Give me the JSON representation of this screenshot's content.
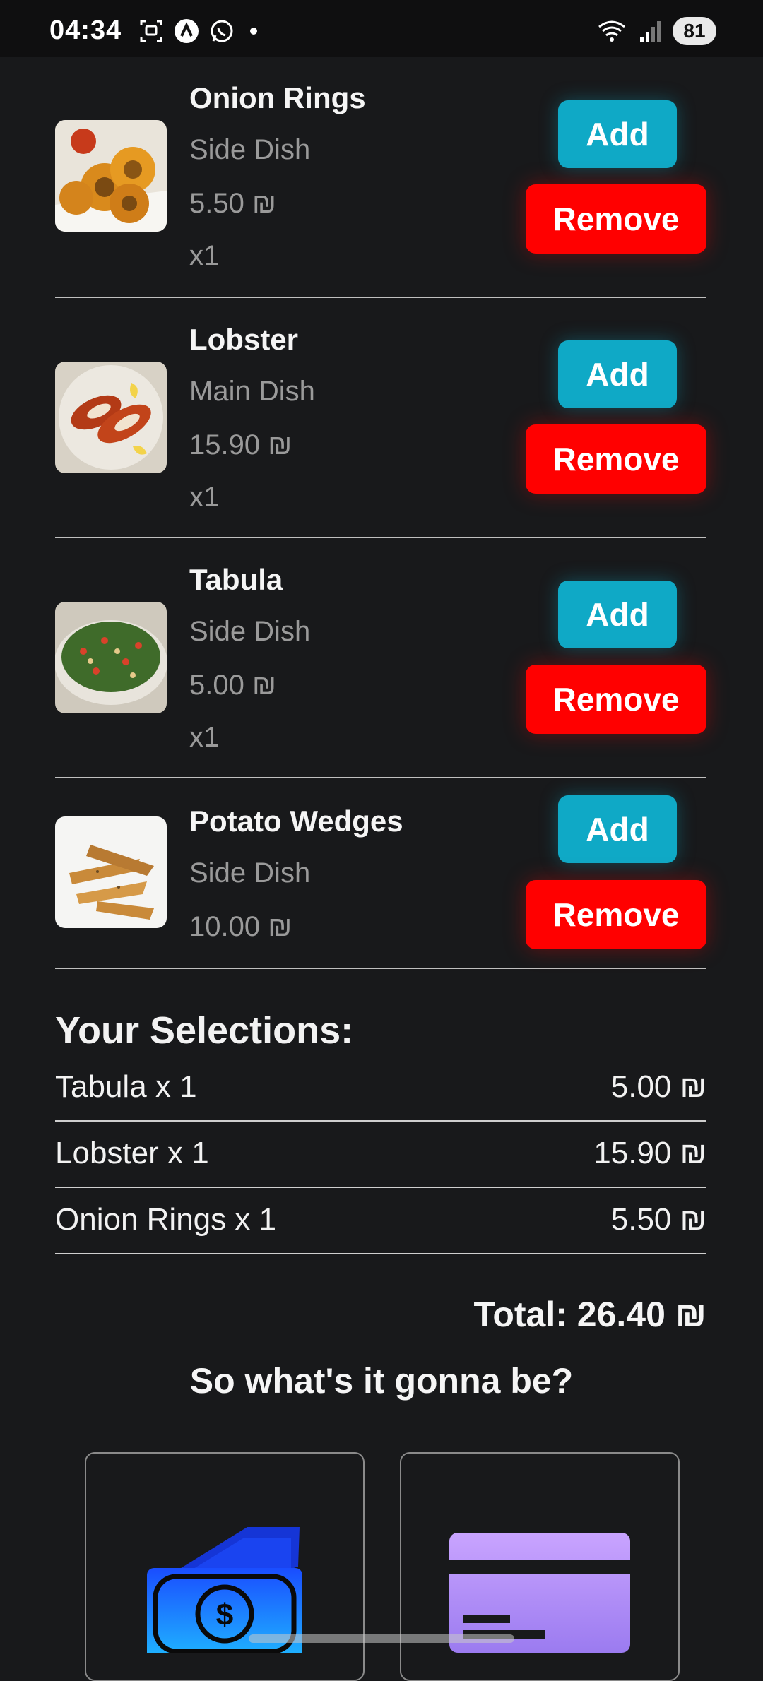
{
  "status_bar": {
    "time": "04:34",
    "battery": "81",
    "icons": [
      "screenshot-icon",
      "app-icon",
      "whatsapp-icon",
      "wifi-icon",
      "signal-icon"
    ]
  },
  "items": [
    {
      "name": "Onion Rings",
      "category": "Side Dish",
      "price": "5.50 ₪",
      "qty": "x1",
      "image": "onion-rings",
      "add_label": "Add",
      "remove_label": "Remove"
    },
    {
      "name": "Lobster",
      "category": "Main Dish",
      "price": "15.90 ₪",
      "qty": "x1",
      "image": "lobster",
      "add_label": "Add",
      "remove_label": "Remove"
    },
    {
      "name": "Tabula",
      "category": "Side Dish",
      "price": "5.00 ₪",
      "qty": "x1",
      "image": "tabula",
      "add_label": "Add",
      "remove_label": "Remove"
    },
    {
      "name": "Potato Wedges",
      "category": "Side Dish",
      "price": "10.00 ₪",
      "image": "potato-wedges",
      "add_label": "Add",
      "remove_label": "Remove"
    }
  ],
  "selections": {
    "title": "Your Selections:",
    "rows": [
      {
        "label": "Tabula x 1",
        "amount": "5.00 ₪"
      },
      {
        "label": "Lobster x 1",
        "amount": "15.90 ₪"
      },
      {
        "label": "Onion Rings x 1",
        "amount": "5.50 ₪"
      }
    ]
  },
  "total": "Total: 26.40 ₪",
  "prompt": "So what's it gonna be?",
  "payment_options": [
    {
      "icon": "cash-icon"
    },
    {
      "icon": "credit-card-icon"
    }
  ],
  "colors": {
    "background": "#18191b",
    "add_button": "#0fa9c6",
    "remove_button": "#ff0000",
    "muted_text": "#9a9a9a"
  }
}
